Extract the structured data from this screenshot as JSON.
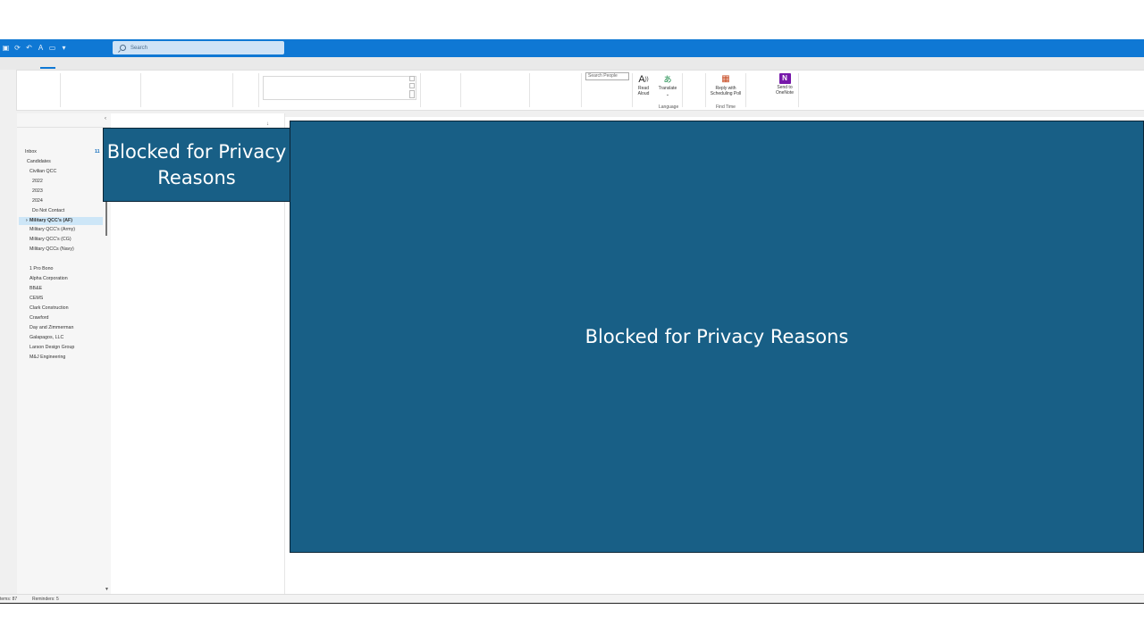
{
  "titlebar": {
    "search_placeholder": "Search",
    "quick_icons": [
      "outlook-icon",
      "sync-icon",
      "undo-icon",
      "read-aloud-icon",
      "touch-mode-icon",
      "customize-icon"
    ]
  },
  "ribbon": {
    "search_people_placeholder": "Search People",
    "read_aloud": "Read\nAloud",
    "translate": "Translate",
    "language_group": "Language",
    "reply_scheduling": "Reply with\nScheduling Poll",
    "find_time_group": "Find Time",
    "send_onenote": "Send to\nOneNote"
  },
  "folders": {
    "inbox": "Inbox",
    "inbox_count": "11",
    "items": [
      "Candidates",
      "Civilian QCC",
      "2022",
      "2023",
      "2024",
      "Do Not Contact",
      "Military QCC's (AF)",
      "Military QCC's (Army)",
      "Military QCC's (CG)",
      "Military QCCs (Navy)",
      "1 Pro Bono",
      "Alpha Corporation",
      "BB&E",
      "CEMS",
      "Clark Construction",
      "Crawford",
      "Day and Zimmerman",
      "Galapagos, LLC",
      "Larson Design Group",
      "M&J Engineering"
    ]
  },
  "status": {
    "items": "tems: 87",
    "reminders": "Reminders: 5"
  },
  "privacy": {
    "small": "Blocked for Privacy Reasons",
    "big": "Blocked for Privacy Reasons"
  },
  "colors": {
    "titlebar": "#0f78d4",
    "privacy_fill": "#185f86",
    "selected_folder": "#cde6f7"
  }
}
